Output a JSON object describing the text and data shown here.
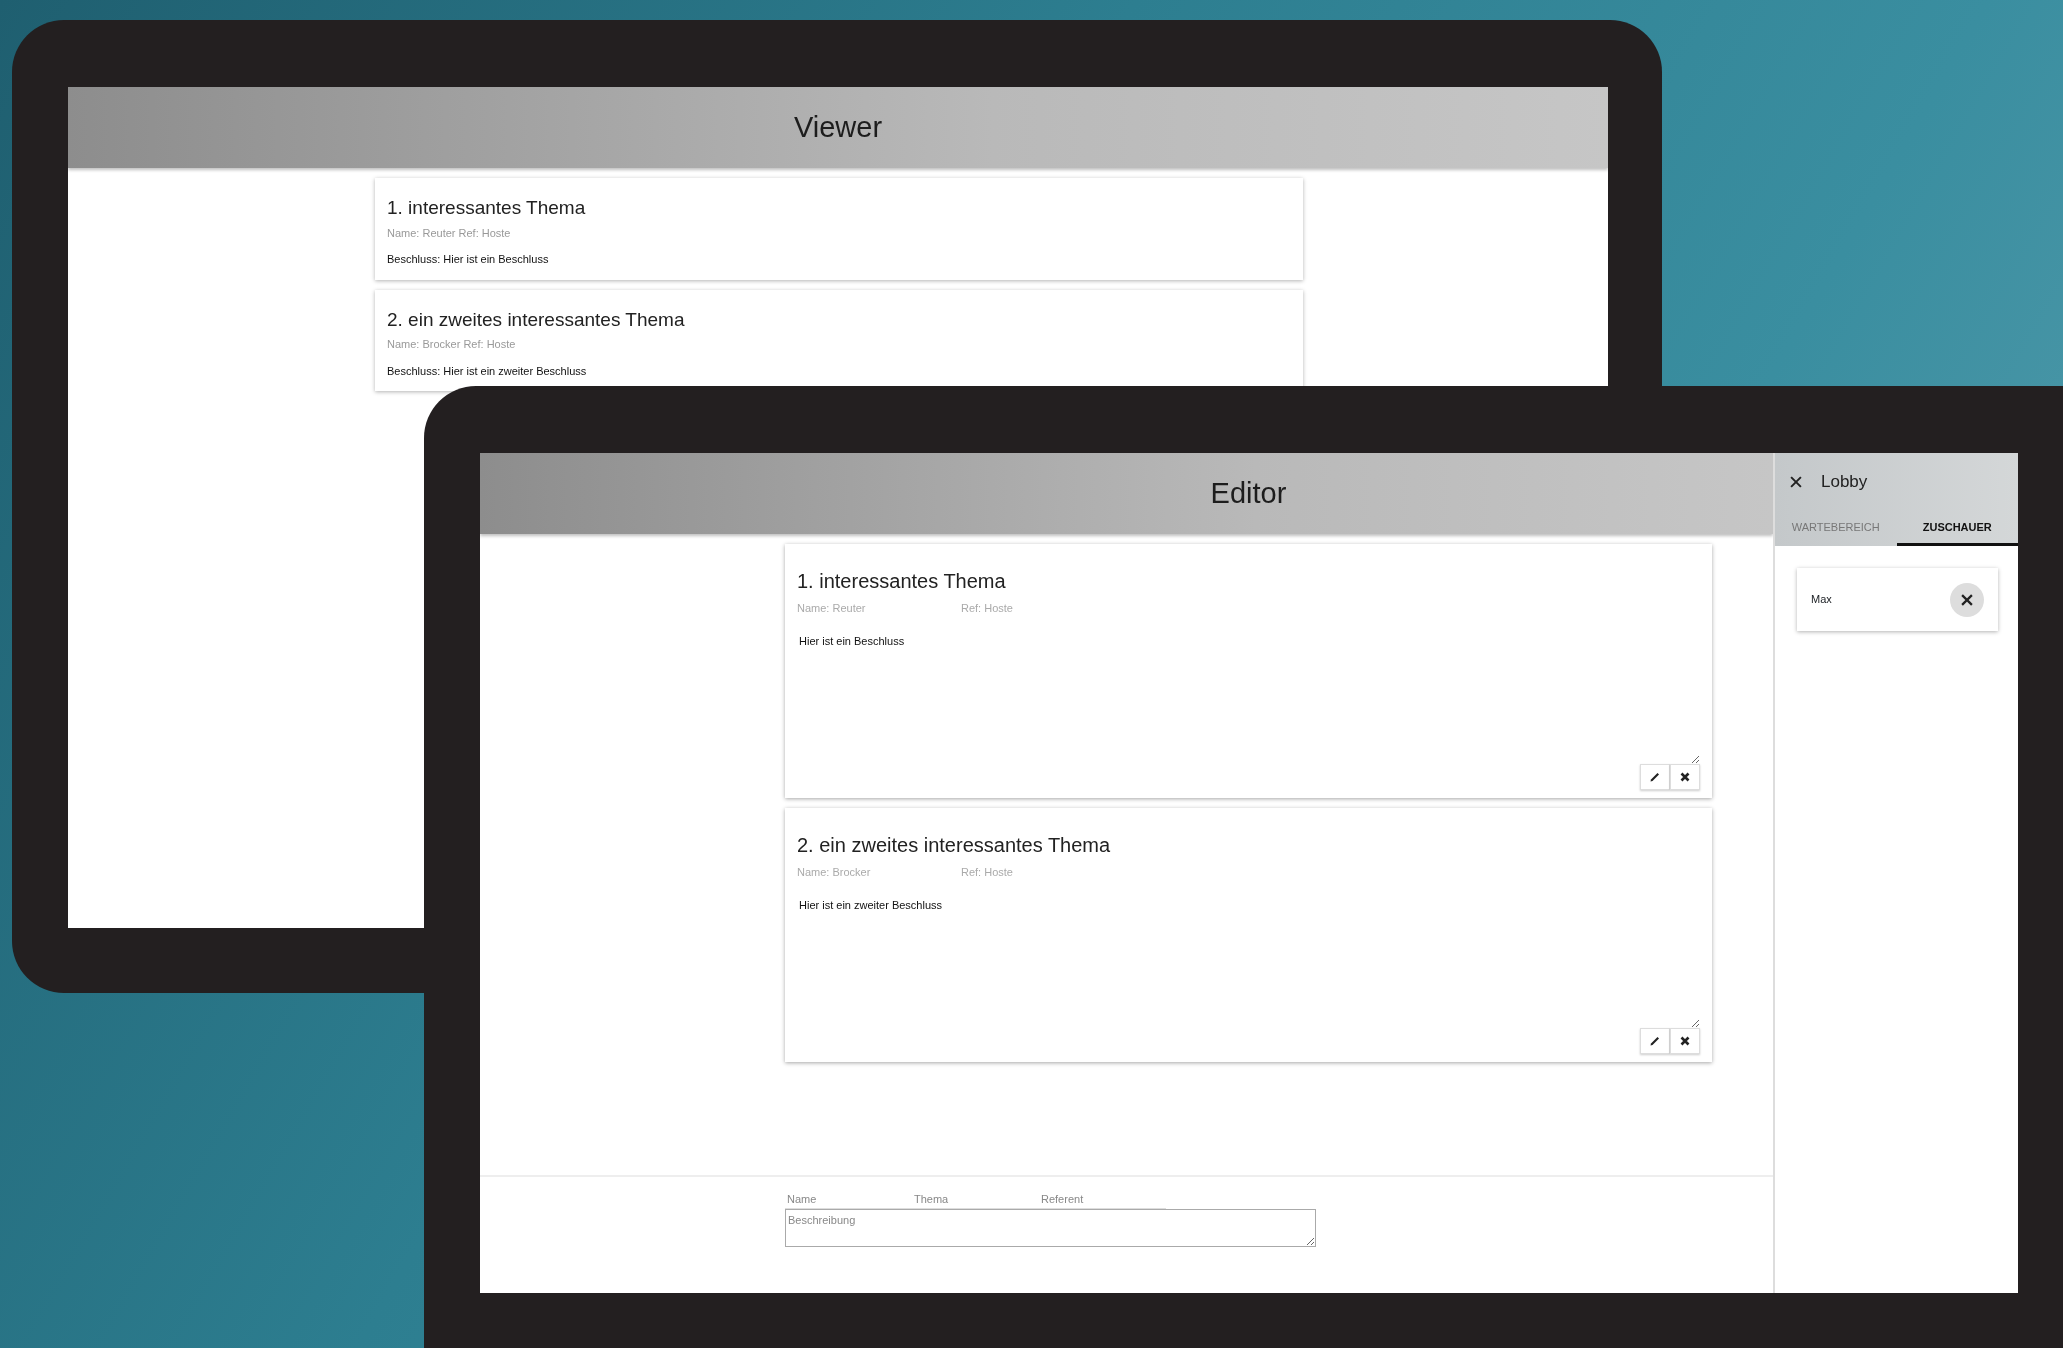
{
  "viewer": {
    "title": "Viewer",
    "topics": [
      {
        "title": "1. interessantes Thema",
        "meta": "Name: Reuter Ref: Hoste",
        "decision": "Beschluss: Hier ist ein Beschluss"
      },
      {
        "title": "2. ein zweites interessantes Thema",
        "meta": "Name: Brocker Ref: Hoste",
        "decision": "Beschluss: Hier ist ein zweiter Beschluss"
      }
    ]
  },
  "editor": {
    "title": "Editor",
    "topics": [
      {
        "number": "1.",
        "title": "interessantes Thema",
        "name": "Name: Reuter",
        "ref": "Ref: Hoste",
        "decision": "Hier ist ein Beschluss"
      },
      {
        "number": "2.",
        "title": "ein zweites interessantes Thema",
        "name": "Name: Brocker",
        "ref": "Ref: Hoste",
        "decision": "Hier ist ein zweiter Beschluss"
      }
    ],
    "form": {
      "fields": [
        {
          "placeholder": "Name"
        },
        {
          "placeholder": "Thema"
        },
        {
          "placeholder": "Referent"
        }
      ],
      "description": {
        "placeholder": "Beschreibung"
      }
    }
  },
  "lobby": {
    "title": "Lobby",
    "tabs": [
      {
        "label": "WARTEBEREICH",
        "selected": false
      },
      {
        "label": "ZUSCHAUER",
        "selected": true
      }
    ],
    "people": [
      {
        "name": "Max"
      }
    ]
  }
}
